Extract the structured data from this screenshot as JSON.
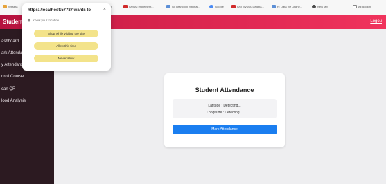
{
  "bookmarks": [
    {
      "label": "Waseta",
      "color": "#e6a33a"
    },
    {
      "label": "Learn",
      "color": "#e6a33a"
    },
    {
      "label": "(20) All Implement...",
      "color": "#d02a2a"
    },
    {
      "label": "Git Branching tutorial...",
      "color": "#5c8fd6"
    },
    {
      "label": "Google",
      "color": "#4a8af4"
    },
    {
      "label": "(26) MySQL Databa...",
      "color": "#d02a2a"
    },
    {
      "label": "R: Data Viz Online...",
      "color": "#5c8fd6"
    },
    {
      "label": "New tab",
      "color": "#4a4a4a"
    },
    {
      "label": "All Bookm",
      "color": "#888888"
    }
  ],
  "header": {
    "brand": "Student Pa",
    "logout": "Logou"
  },
  "sidebar": {
    "items": [
      {
        "label": "ashboard"
      },
      {
        "label": "ark Attendance"
      },
      {
        "label": "y Attendance"
      },
      {
        "label": "nroll Course"
      },
      {
        "label": "can QR"
      },
      {
        "label": "lood Analysis"
      }
    ]
  },
  "card": {
    "title": "Student Attendance",
    "latitude": "Latitude : Detecting...",
    "longitude": "Longitude : Detecting...",
    "button": "Mark Attendance"
  },
  "popup": {
    "title": "https://localhost:57787 wants to",
    "close": "×",
    "subtitle": "Know your location",
    "buttons": [
      {
        "label": "Allow while visiting the site"
      },
      {
        "label": "Allow this time"
      },
      {
        "label": "Never allow"
      }
    ]
  }
}
